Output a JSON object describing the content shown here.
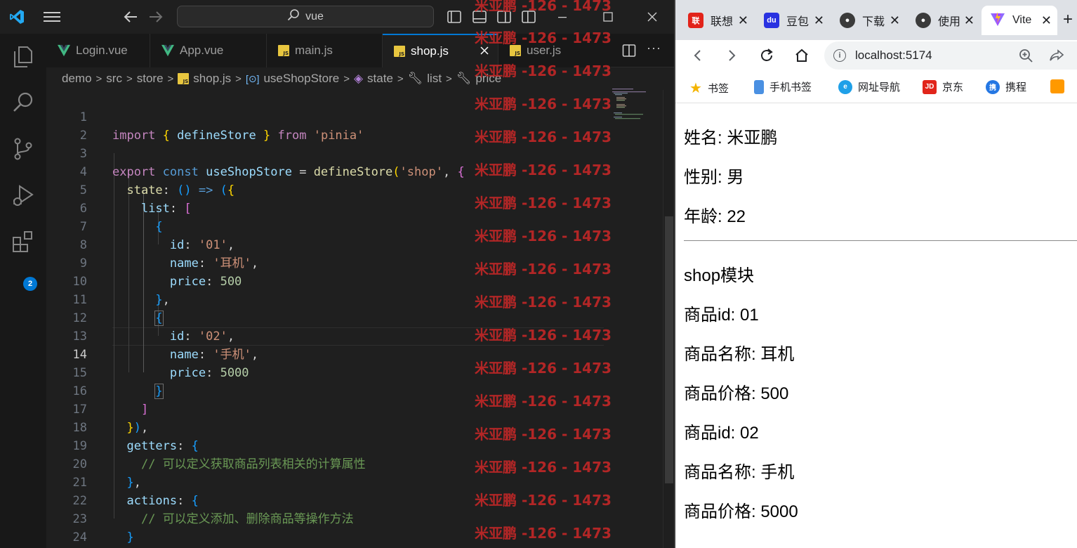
{
  "colors": {
    "editor_bg": "#1f1f1f",
    "accent": "#0078d4",
    "watermark": "#cd2828",
    "keyword": "#c586c0",
    "string": "#ce9178",
    "number": "#b5cea8",
    "comment": "#6a9955"
  },
  "vscode": {
    "search_text": "vue",
    "icons": [
      "vscode-logo",
      "hamburger-menu-icon",
      "back-arrow-icon",
      "forward-arrow-icon",
      "search-icon",
      "toggle-sidebar-icon",
      "toggle-panel-icon",
      "toggle-secondary-sidebar-icon",
      "customize-layout-icon",
      "minimize-icon",
      "maximize-icon",
      "close-icon"
    ],
    "activity_bar": {
      "items": [
        "explorer-icon",
        "search-icon",
        "source-control-icon",
        "run-debug-icon",
        "extensions-icon"
      ],
      "extensions_badge": "2"
    },
    "tabs": [
      {
        "label": "Login.vue",
        "icon": "vue-icon"
      },
      {
        "label": "App.vue",
        "icon": "vue-icon"
      },
      {
        "label": "main.js",
        "icon": "js-icon"
      },
      {
        "label": "shop.js",
        "icon": "js-icon",
        "active": true
      },
      {
        "label": "user.js",
        "icon": "js-icon"
      }
    ],
    "breadcrumbs": [
      "demo",
      "src",
      "store",
      "shop.js",
      "useShopStore",
      "state",
      "list",
      "price"
    ],
    "current_line": 14,
    "line_numbers": [
      "1",
      "2",
      "3",
      "4",
      "5",
      "6",
      "7",
      "8",
      "9",
      "10",
      "11",
      "12",
      "13",
      "14",
      "15",
      "16",
      "17",
      "18",
      "19",
      "20",
      "21",
      "22",
      "23",
      "24"
    ],
    "code": {
      "l1": [
        "import",
        "{",
        "defineStore",
        "}",
        "from",
        "'pinia'"
      ],
      "l3": [
        "export",
        "const",
        "useShopStore",
        "=",
        "defineStore",
        "(",
        "'shop'",
        ",",
        "{"
      ],
      "l4": [
        "state",
        ":",
        "()",
        "=>",
        "(",
        "{"
      ],
      "l5": [
        "list",
        ":",
        "["
      ],
      "l6": [
        "{"
      ],
      "l7": [
        "id",
        ":",
        "'01'",
        ","
      ],
      "l8": [
        "name",
        ":",
        "'耳机'",
        ","
      ],
      "l9": [
        "price",
        ":",
        "500"
      ],
      "l10": [
        "}",
        ","
      ],
      "l11": [
        "{"
      ],
      "l12": [
        "id",
        ":",
        "'02'",
        ","
      ],
      "l13": [
        "name",
        ":",
        "'手机'",
        ","
      ],
      "l14": [
        "price",
        ":",
        "5000"
      ],
      "l15": [
        "}"
      ],
      "l16": [
        "]"
      ],
      "l17": [
        "}",
        ")",
        ","
      ],
      "l18": [
        "getters",
        ":",
        "{"
      ],
      "l19": [
        "// 可以定义获取商品列表相关的计算属性"
      ],
      "l20": [
        "}",
        ","
      ],
      "l21": [
        "actions",
        ":",
        "{"
      ],
      "l22": [
        "// 可以定义添加、删除商品等操作方法"
      ],
      "l23": [
        "}"
      ],
      "l24": [
        "}",
        ")"
      ]
    },
    "watermark_text": "米亚鹏 -126 - 1473"
  },
  "browser": {
    "tabs": [
      {
        "label": "联想",
        "icon": "lenovo-icon"
      },
      {
        "label": "豆包",
        "icon": "baidu-icon"
      },
      {
        "label": "下载",
        "icon": "avatar-icon"
      },
      {
        "label": "使用",
        "icon": "avatar-icon"
      },
      {
        "label": "Vite",
        "icon": "vite-icon",
        "active": true
      }
    ],
    "url": "localhost:5174",
    "bookmarks": [
      {
        "label": "书签",
        "icon": "star-icon"
      },
      {
        "label": "手机书签",
        "icon": "phone-icon"
      },
      {
        "label": "网址导航",
        "icon": "edge-icon"
      },
      {
        "label": "京东",
        "icon": "jd-icon"
      },
      {
        "label": "携程",
        "icon": "ctrip-icon"
      }
    ],
    "page": {
      "name_line": "姓名: 米亚鹏",
      "gender_line": "性别: 男",
      "age_line": "年龄: 22",
      "section_title": "shop模块",
      "items": [
        {
          "id_line": "商品id: 01",
          "name_line": "商品名称: 耳机",
          "price_line": "商品价格: 500"
        },
        {
          "id_line": "商品id: 02",
          "name_line": "商品名称: 手机",
          "price_line": "商品价格: 5000"
        }
      ]
    }
  }
}
